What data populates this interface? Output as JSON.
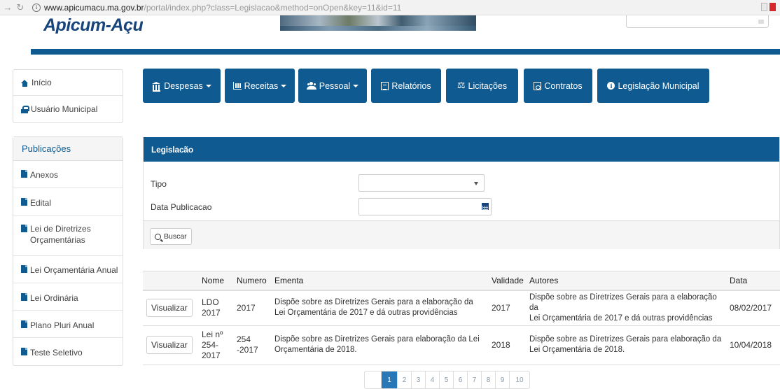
{
  "browser": {
    "back_glyph": "→",
    "reload_glyph": "↻",
    "info_glyph": "i",
    "url_domain": "www.apicumacu.ma.gov.br",
    "url_path": "/portal/index.php?class=Legislacao&method=onOpen&key=11&id=11"
  },
  "header": {
    "logo": "Apicum-Açu",
    "accent_color": "#0e5a91"
  },
  "sidebar": {
    "top_items": [
      {
        "label": "Início",
        "icon": "home-icon"
      },
      {
        "label": "Usuário Municipal",
        "icon": "lock-icon"
      }
    ],
    "publications_title": "Publicações",
    "publications": [
      "Anexos",
      "Edital",
      "Lei de Diretrizes Orçamentárias",
      "Lei Orçamentária Anual",
      "Lei Ordinária",
      "Plano Pluri Anual",
      "Teste Seletivo"
    ]
  },
  "nav": {
    "despesas": "Despesas",
    "receitas": "Receitas",
    "pessoal": "Pessoal",
    "relatorios": "Relatórios",
    "licitacoes": "Licitações",
    "contratos": "Contratos",
    "legislacao": "Legislação Municipal",
    "scale_glyph": "⚖",
    "info_glyph": "i"
  },
  "form": {
    "title": "Legislacão",
    "tipo_label": "Tipo",
    "tipo_value": "",
    "data_label": "Data Publicacao",
    "data_value": "",
    "search_button": "Buscar"
  },
  "table": {
    "headers": {
      "nome": "Nome",
      "numero": "Numero",
      "ementa": "Ementa",
      "validade": "Validade",
      "autores": "Autores",
      "data": "Data"
    },
    "view_label": "Visualizar",
    "rows": [
      {
        "nome": [
          "LDO",
          "2017"
        ],
        "numero": [
          "2017"
        ],
        "ementa": [
          "Dispõe sobre as Diretrizes Gerais para a elaboração da",
          "Lei Orçamentária de 2017 e dá outras providências"
        ],
        "validade": "2017",
        "autores": [
          "Dispõe sobre as Diretrizes Gerais para a elaboração da",
          "Lei Orçamentária de 2017 e dá outras providências"
        ],
        "data": "08/02/2017"
      },
      {
        "nome": [
          "Lei nº",
          "254-",
          "2017"
        ],
        "numero": [
          "254",
          "-2017"
        ],
        "ementa": [
          "Dispõe sobre as Diretrizes Gerais para elaboração da Lei",
          "Orçamentária de 2018."
        ],
        "validade": "2018",
        "autores": [
          "Dispõe sobre as Diretrizes Gerais para elaboração da",
          "Lei Orçamentária de 2018."
        ],
        "data": "10/04/2018"
      }
    ]
  },
  "pagination": {
    "pages": [
      "1",
      "2",
      "3",
      "4",
      "5",
      "6",
      "7",
      "8",
      "9",
      "10"
    ],
    "active": "1"
  }
}
